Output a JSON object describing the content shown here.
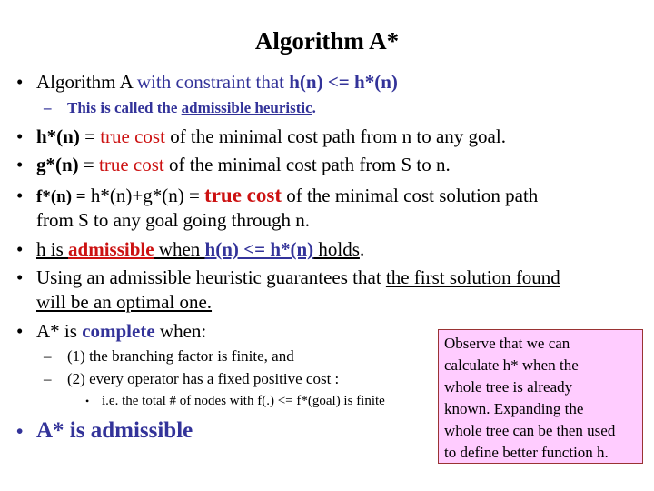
{
  "slide": {
    "title": "Algorithm A*",
    "bullet_1": {
      "text_a": "Algorithm A",
      "text_b": " with constraint that ",
      "text_c": "h(n) <= h*(n)"
    },
    "sub_1": {
      "text_a": "This is called the ",
      "text_b": "admissible heuristic",
      "text_c": "."
    },
    "bullet_2": {
      "term": "h*(n)",
      "eq": " = ",
      "highlight": "true cost",
      "rest": " of the minimal cost path from n to any goal."
    },
    "bullet_3": {
      "term": "g*(n)",
      "eq": " = ",
      "highlight": "true cost",
      "rest": " of the minimal cost path from S  to n."
    },
    "bullet_4": {
      "term": "f*(n) =",
      "eq": " h*(n)+g*(n) = ",
      "highlight": "true cost",
      "rest": " of the minimal cost solution path",
      "cont": "from S  to any goal going through n."
    },
    "bullet_5": {
      "text_a": "h is ",
      "text_b": "admissible",
      "text_c": " when ",
      "text_d": "h(n) <= h*(n)",
      "text_e": " holds",
      "text_f": "."
    },
    "bullet_6": {
      "text_a": "Using an admissible heuristic guarantees that ",
      "text_b": "the first solution found",
      "cont": "will be an optimal one."
    },
    "bullet_7": {
      "text_a": "A* is ",
      "text_b": "complete",
      "text_c": " when:"
    },
    "sub_2": "(1) the branching factor is finite, and",
    "sub_3": "(2) every operator has a fixed positive cost :",
    "subsub_1": "i.e. the total # of nodes with f(.) <= f*(goal) is finite",
    "bullet_8": "A* is admissible",
    "note": {
      "lines": [
        "Observe that we can",
        "calculate h* when the",
        "whole tree is already",
        "known. Expanding the",
        "whole tree can be then used",
        "to define better function h."
      ]
    },
    "glyphs": {
      "bullet": "•",
      "dash": "–"
    },
    "colors": {
      "blue": "#333399",
      "red": "#cc1111",
      "note_bg": "#ffccff",
      "note_border": "#993333"
    }
  }
}
